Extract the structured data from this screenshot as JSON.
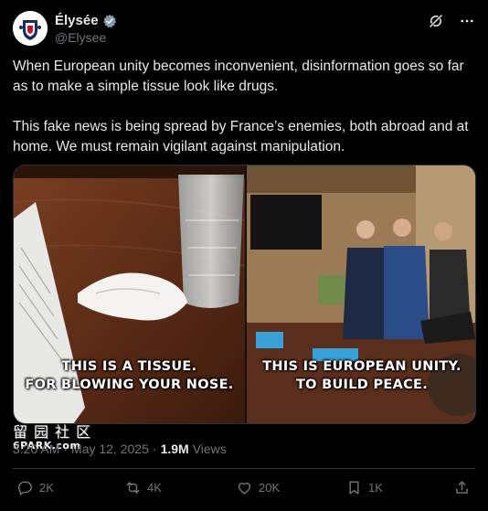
{
  "author": {
    "display_name": "Élysée",
    "handle": "@Elysee",
    "verified": true,
    "avatar_icon": "elysee-seal-icon"
  },
  "header_actions": [
    "grok-icon",
    "more-icon"
  ],
  "tweet": {
    "text": "When European unity becomes inconvenient, disinformation goes so far as to make a simple tissue look like drugs.\n\nThis fake news is being spread by France’s enemies, both abroad and at home. We must remain vigilant against manipulation."
  },
  "media": {
    "left_caption": "THIS IS A TISSUE.\nFOR BLOWING YOUR NOSE.",
    "right_caption": "THIS IS EUROPEAN UNITY.\nTO BUILD PEACE."
  },
  "watermark": {
    "chinese": "留园社区",
    "site": "6PARK.com"
  },
  "meta": {
    "time": "3:20 AM",
    "separator": "·",
    "date": "May 12, 2025",
    "views_count": "1.9M",
    "views_label": "Views"
  },
  "actions": {
    "replies": "2K",
    "reposts": "4K",
    "likes": "20K",
    "bookmarks": "1K"
  },
  "colors": {
    "background": "#000000",
    "primary_text": "#e7e9ea",
    "secondary_text": "#71767b",
    "verified_badge": "#829aab",
    "divider": "#2f3336"
  }
}
